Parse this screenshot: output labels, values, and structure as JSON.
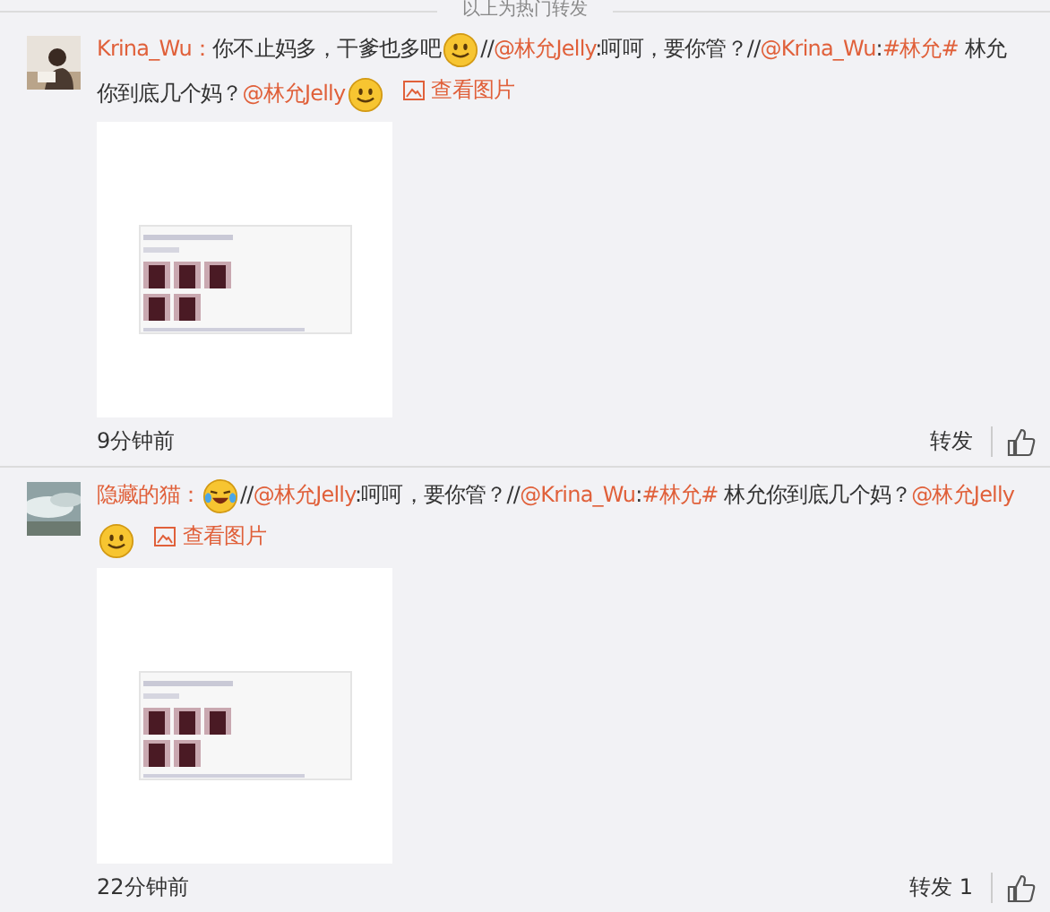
{
  "header": {
    "text": "以上为热门转发"
  },
  "posts": [
    {
      "user": "Krina_Wu",
      "separator": "：",
      "segments": [
        {
          "kind": "text",
          "text": "你不止妈多，干爹也多吧"
        },
        {
          "kind": "smile"
        },
        {
          "kind": "text",
          "text": "//"
        },
        {
          "kind": "mention",
          "text": "@林允Jelly"
        },
        {
          "kind": "text",
          "text": ":呵呵，要你管？//"
        },
        {
          "kind": "mention",
          "text": "@Krina_Wu"
        },
        {
          "kind": "text",
          "text": ":"
        },
        {
          "kind": "mention",
          "text": "#林允#"
        },
        {
          "kind": "text",
          "text": " 林允"
        },
        {
          "kind": "text",
          "text": "你到底几个妈？"
        },
        {
          "kind": "mention",
          "text": "@林允Jelly"
        },
        {
          "kind": "smile"
        }
      ],
      "view_image": "查看图片",
      "time": "9分钟前",
      "repost": "转发"
    },
    {
      "user": "隐藏的猫",
      "separator": "：",
      "segments": [
        {
          "kind": "laugh"
        },
        {
          "kind": "text",
          "text": "//"
        },
        {
          "kind": "mention",
          "text": "@林允Jelly"
        },
        {
          "kind": "text",
          "text": ":呵呵，要你管？//"
        },
        {
          "kind": "mention",
          "text": "@Krina_Wu"
        },
        {
          "kind": "text",
          "text": ":"
        },
        {
          "kind": "mention",
          "text": "#林允#"
        },
        {
          "kind": "text",
          "text": " 林允你到底几个妈？"
        },
        {
          "kind": "mention",
          "text": "@林允Jelly"
        },
        {
          "kind": "smile"
        }
      ],
      "view_image": "查看图片",
      "time": "22分钟前",
      "repost": "转发",
      "repost_count": "1"
    }
  ]
}
